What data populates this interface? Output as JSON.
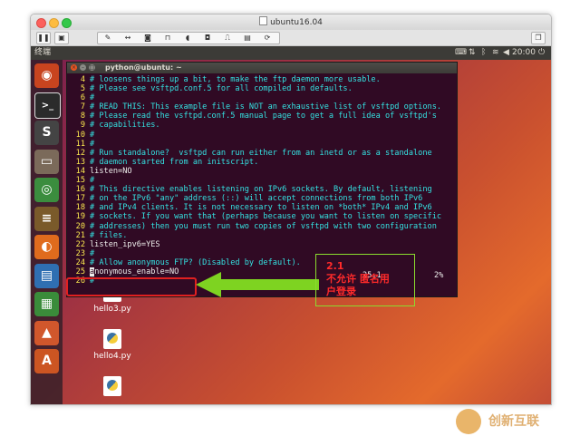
{
  "vm_window": {
    "title": "ubuntu16.04",
    "toolbar_icons": [
      "pause-icon",
      "snapshot-icon",
      "wrench-icon",
      "arrows-icon",
      "disk-icon",
      "lock-icon",
      "audio-icon",
      "camera-icon",
      "usb-icon",
      "folder-icon",
      "print-icon",
      "refresh-icon",
      "expand-icon"
    ],
    "restore_icon": "window-restore-icon"
  },
  "ubuntu_panel": {
    "app_name": "终端",
    "time": "20:00",
    "indicators": [
      "keyboard-icon",
      "sort-icon",
      "bluetooth-icon",
      "wifi-icon",
      "volume-icon",
      "power-icon"
    ]
  },
  "launcher": {
    "items": [
      {
        "name": "ubuntu-logo-icon",
        "glyph": "◉",
        "color": "#c8441f"
      },
      {
        "name": "terminal-icon",
        "glyph": ">_",
        "color": "#2b2b2b"
      },
      {
        "name": "sublime-icon",
        "glyph": "S",
        "color": "#444444"
      },
      {
        "name": "files-icon",
        "glyph": "▭",
        "color": "#7b6a5a"
      },
      {
        "name": "chrome-icon",
        "glyph": "◎",
        "color": "#3b8d3e"
      },
      {
        "name": "books-icon",
        "glyph": "≡",
        "color": "#7a5a2a"
      },
      {
        "name": "firefox-icon",
        "glyph": "◐",
        "color": "#e06b1d"
      },
      {
        "name": "writer-icon",
        "glyph": "▤",
        "color": "#2f6fb2"
      },
      {
        "name": "calc-icon",
        "glyph": "▦",
        "color": "#3a8c3a"
      },
      {
        "name": "impress-icon",
        "glyph": "▲",
        "color": "#d1572c"
      },
      {
        "name": "software-icon",
        "glyph": "A",
        "color": "#cc5522"
      }
    ]
  },
  "terminal": {
    "title": "python@ubuntu: ~",
    "lines": [
      {
        "num": "4",
        "text": "# loosens things up a bit, to make the ftp daemon more usable.",
        "kind": "cm"
      },
      {
        "num": "5",
        "text": "# Please see vsftpd.conf.5 for all compiled in defaults.",
        "kind": "cm"
      },
      {
        "num": "6",
        "text": "#",
        "kind": "cm"
      },
      {
        "num": "7",
        "text": "# READ THIS: This example file is NOT an exhaustive list of vsftpd options.",
        "kind": "cm"
      },
      {
        "num": "8",
        "text": "# Please read the vsftpd.conf.5 manual page to get a full idea of vsftpd's",
        "kind": "cm"
      },
      {
        "num": "9",
        "text": "# capabilities.",
        "kind": "cm"
      },
      {
        "num": "10",
        "text": "#",
        "kind": "cm"
      },
      {
        "num": "11",
        "text": "#",
        "kind": "cm"
      },
      {
        "num": "12",
        "text": "# Run standalone?  vsftpd can run either from an inetd or as a standalone",
        "kind": "cm"
      },
      {
        "num": "13",
        "text": "# daemon started from an initscript.",
        "kind": "cm"
      },
      {
        "num": "14",
        "text": "listen=NO",
        "kind": "cd"
      },
      {
        "num": "15",
        "text": "#",
        "kind": "cm"
      },
      {
        "num": "16",
        "text": "# This directive enables listening on IPv6 sockets. By default, listening",
        "kind": "cm"
      },
      {
        "num": "17",
        "text": "# on the IPv6 \"any\" address (::) will accept connections from both IPv6",
        "kind": "cm"
      },
      {
        "num": "18",
        "text": "# and IPv4 clients. It is not necessary to listen on *both* IPv4 and IPv6",
        "kind": "cm"
      },
      {
        "num": "19",
        "text": "# sockets. If you want that (perhaps because you want to listen on specific",
        "kind": "cm"
      },
      {
        "num": "20",
        "text": "# addresses) then you must run two copies of vsftpd with two configuration",
        "kind": "cm"
      },
      {
        "num": "21",
        "text": "# files.",
        "kind": "cm"
      },
      {
        "num": "22",
        "text": "listen_ipv6=YES",
        "kind": "cd"
      },
      {
        "num": "23",
        "text": "#",
        "kind": "cm"
      },
      {
        "num": "24",
        "text": "# Allow anonymous FTP? (Disabled by default).",
        "kind": "cm"
      },
      {
        "num": "25",
        "text": "anonymous_enable=NO",
        "kind": "cd",
        "cursor": true
      },
      {
        "num": "26",
        "text": "#",
        "kind": "cm"
      }
    ],
    "status_pos": "25,1",
    "status_pct": "2%"
  },
  "annotation": {
    "label_num": "2.1",
    "label_line1": "不允许 匿名用",
    "label_line2": "户登录",
    "arrow_color": "#7ed321",
    "box_color": "#e02020"
  },
  "desktop_files": [
    {
      "name": "hello3.py"
    },
    {
      "name": "hello4.py"
    },
    {
      "name": ""
    }
  ],
  "watermark": {
    "text": "创新互联"
  }
}
